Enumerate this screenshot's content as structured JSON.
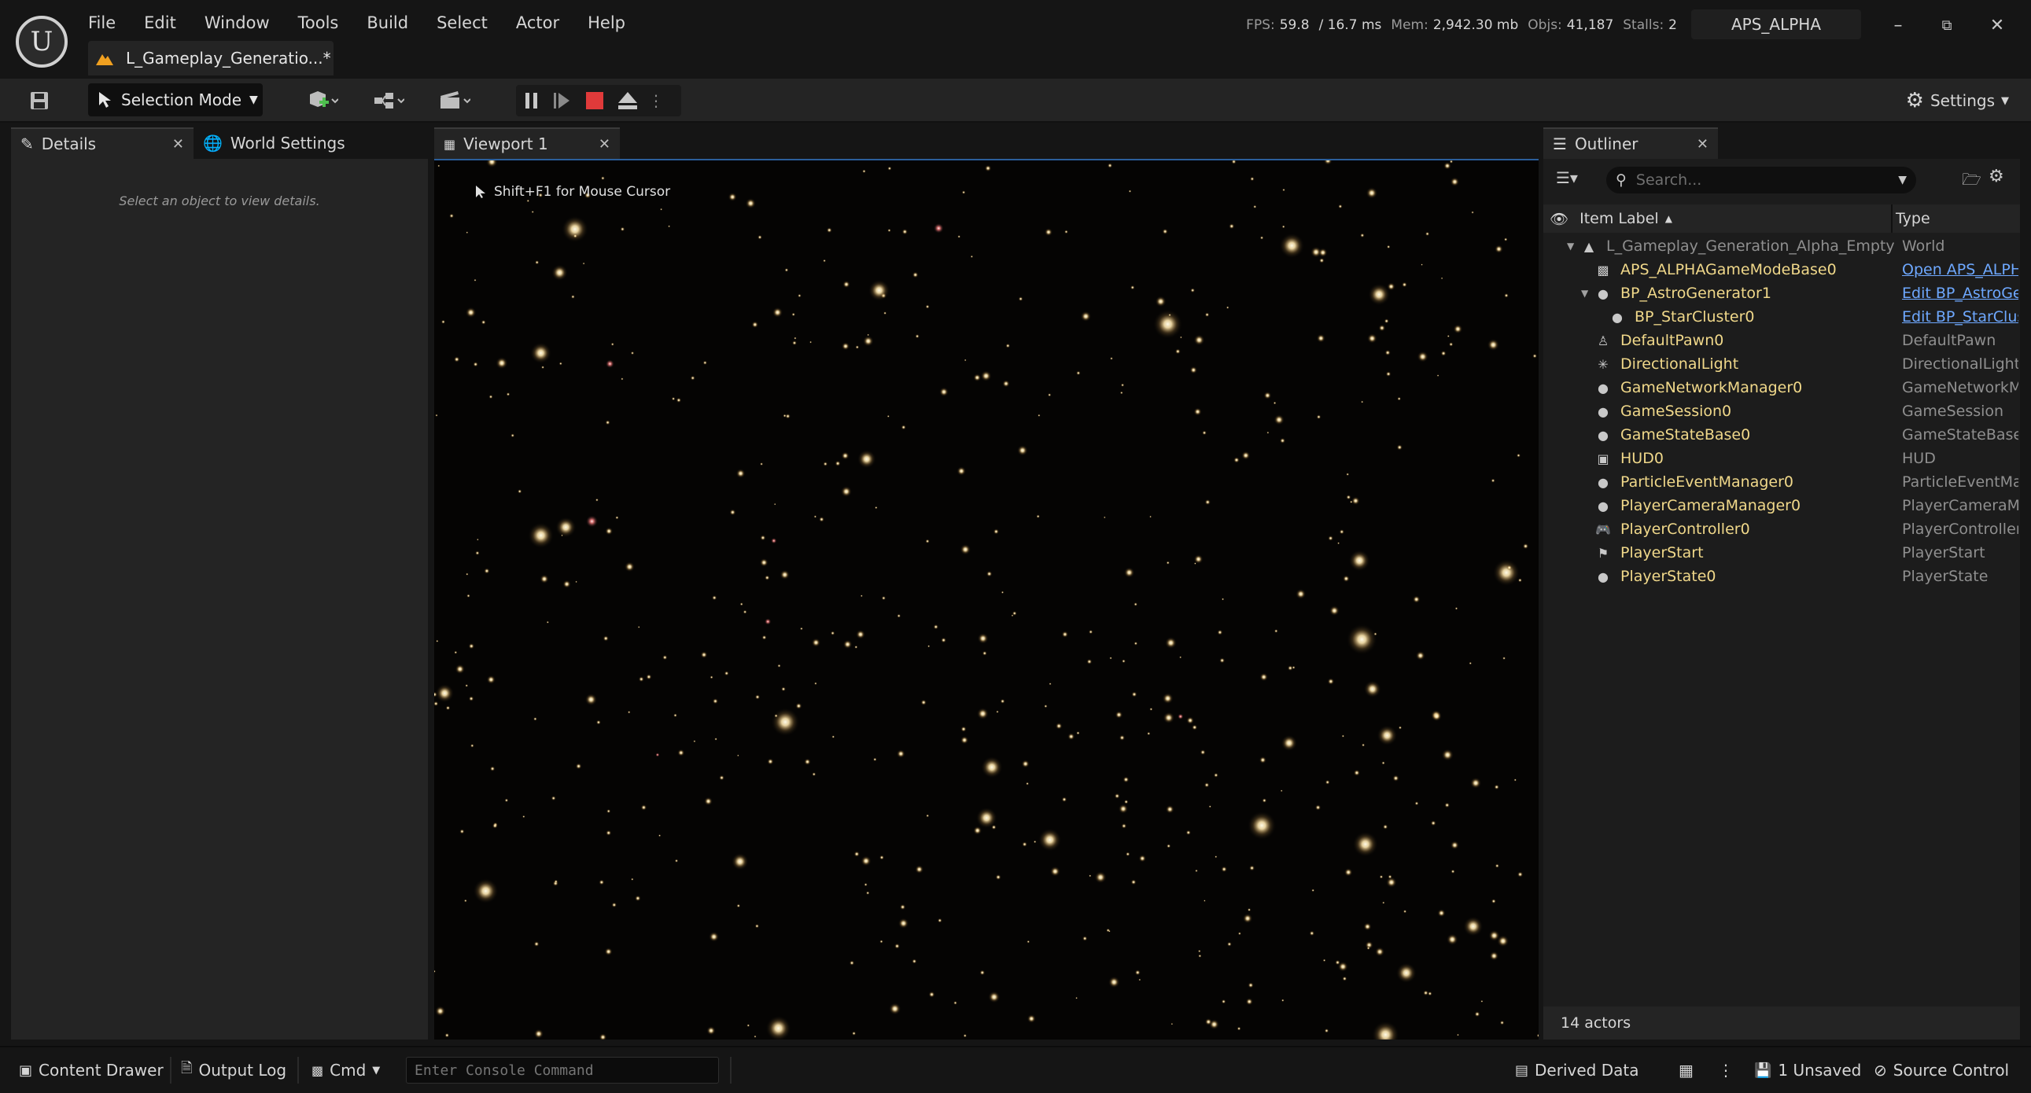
{
  "menu": [
    "File",
    "Edit",
    "Window",
    "Tools",
    "Build",
    "Select",
    "Actor",
    "Help"
  ],
  "document_tab": "L_Gameplay_Generatio...*",
  "stats": {
    "fps_label": "FPS:",
    "fps": "59.8",
    "frame_time": "/ 16.7 ms",
    "mem_label": "Mem:",
    "mem": "2,942.30 mb",
    "objs_label": "Objs:",
    "objs": "41,187",
    "stalls_label": "Stalls:",
    "stalls": "2"
  },
  "project_name": "APS_ALPHA",
  "toolbar": {
    "selection_mode": "Selection Mode",
    "settings": "Settings"
  },
  "left_panel": {
    "tabs": [
      "Details",
      "World Settings"
    ],
    "empty_message": "Select an object to view details."
  },
  "viewport": {
    "tab": "Viewport 1",
    "hint": "Shift+F1 for Mouse Cursor"
  },
  "outliner": {
    "title": "Outliner",
    "search_placeholder": "Search...",
    "columns": {
      "label": "Item Label",
      "type": "Type"
    },
    "rows": [
      {
        "label": "L_Gameplay_Generation_Alpha_Empty",
        "type": "World",
        "indent": 0,
        "expander": true,
        "icon": "level-icon",
        "dim": true
      },
      {
        "label": "APS_ALPHAGameModeBase0",
        "type": "Open APS_ALPHAGameModeBase",
        "indent": 1,
        "icon": "game-mode-icon",
        "link": true
      },
      {
        "label": "BP_AstroGenerator1",
        "type": "Edit BP_AstroGenerator",
        "indent": 1,
        "expander": true,
        "icon": "actor-icon",
        "link": true
      },
      {
        "label": "BP_StarCluster0",
        "type": "Edit BP_StarCluster",
        "indent": 2,
        "icon": "actor-icon",
        "link": true
      },
      {
        "label": "DefaultPawn0",
        "type": "DefaultPawn",
        "indent": 1,
        "icon": "pawn-icon"
      },
      {
        "label": "DirectionalLight",
        "type": "DirectionalLight",
        "indent": 1,
        "icon": "light-icon"
      },
      {
        "label": "GameNetworkManager0",
        "type": "GameNetworkManager",
        "indent": 1,
        "icon": "actor-icon"
      },
      {
        "label": "GameSession0",
        "type": "GameSession",
        "indent": 1,
        "icon": "actor-icon"
      },
      {
        "label": "GameStateBase0",
        "type": "GameStateBase",
        "indent": 1,
        "icon": "actor-icon"
      },
      {
        "label": "HUD0",
        "type": "HUD",
        "indent": 1,
        "icon": "hud-icon"
      },
      {
        "label": "ParticleEventManager0",
        "type": "ParticleEventManager",
        "indent": 1,
        "icon": "actor-icon"
      },
      {
        "label": "PlayerCameraManager0",
        "type": "PlayerCameraManager",
        "indent": 1,
        "icon": "actor-icon"
      },
      {
        "label": "PlayerController0",
        "type": "PlayerController",
        "indent": 1,
        "icon": "gamepad-icon"
      },
      {
        "label": "PlayerStart",
        "type": "PlayerStart",
        "indent": 1,
        "icon": "flag-icon"
      },
      {
        "label": "PlayerState0",
        "type": "PlayerState",
        "indent": 1,
        "icon": "actor-icon"
      }
    ],
    "actor_count": "14 actors"
  },
  "statusbar": {
    "content_drawer": "Content Drawer",
    "output_log": "Output Log",
    "cmd": "Cmd",
    "console_placeholder": "Enter Console Command",
    "derived_data": "Derived Data",
    "unsaved": "1 Unsaved",
    "source_control": "Source Control"
  },
  "colors": {
    "accent_blue": "#2b5e9a",
    "stop_red": "#e03a3a",
    "actor_label": "#f0d88a",
    "link": "#6ea8ff"
  }
}
